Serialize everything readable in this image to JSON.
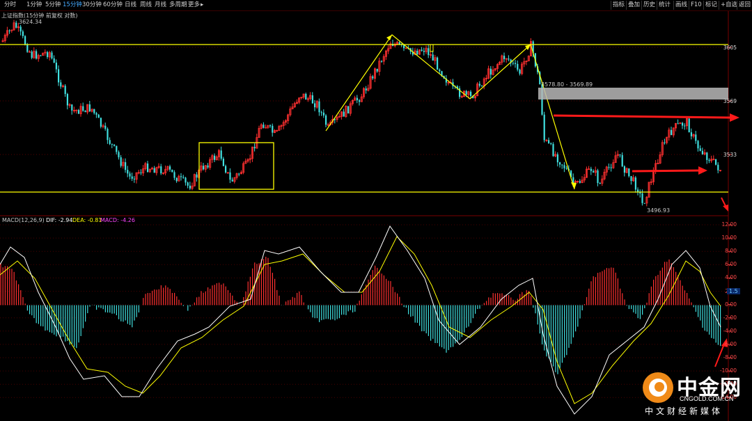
{
  "toolbar": {
    "left_tabs": [
      "分时",
      "1分钟",
      "5分钟",
      "15分钟",
      "30分钟",
      "60分钟",
      "日线",
      "周线",
      "月线",
      "多周期",
      "更多"
    ],
    "active_tab": "15分钟",
    "more_arrow": "▸",
    "right_tabs": [
      "指标",
      "叠加",
      "历史",
      "统计",
      "画线",
      "F10",
      "标记",
      "+自选",
      "返回"
    ]
  },
  "chart": {
    "title": "上证指数(15分钟 前复权 对数)",
    "high_label": "3624.34",
    "low_label": "3496.93",
    "zone_label": "3578.80 - 3569.89",
    "price_ticks": [
      "3605",
      "3569",
      "3533"
    ],
    "colors": {
      "up": "#ff3030",
      "down": "#40e0e0",
      "trend": "#ffff00",
      "arrow": "#ff1a1a",
      "zone": "#b8b8b8"
    }
  },
  "macd": {
    "title": "MACD(12,26,9)",
    "dif": "DIF: -2.94",
    "dea": "DEA: -0.81",
    "macd": "MACD: -4.26",
    "ticks": [
      "12.00",
      "10.00",
      "8.00",
      "6.00",
      "4.00",
      "2.00",
      "0.00",
      "-2.00",
      "-4.00",
      "-6.00",
      "-8.00",
      "-10.00",
      "-12.00",
      "-14.00"
    ],
    "marker": "1.5",
    "colors": {
      "dif": "#ffffff",
      "dea": "#ffff00",
      "title": "#c8c8c8",
      "dif_label": "#ffffff",
      "dea_label": "#ffff00",
      "macd_label": "#ff44ff"
    }
  },
  "watermark": {
    "brand": "中金网",
    "domain": "CNGOLD.COM.CN",
    "slogan": "中文财经新媒体"
  }
}
